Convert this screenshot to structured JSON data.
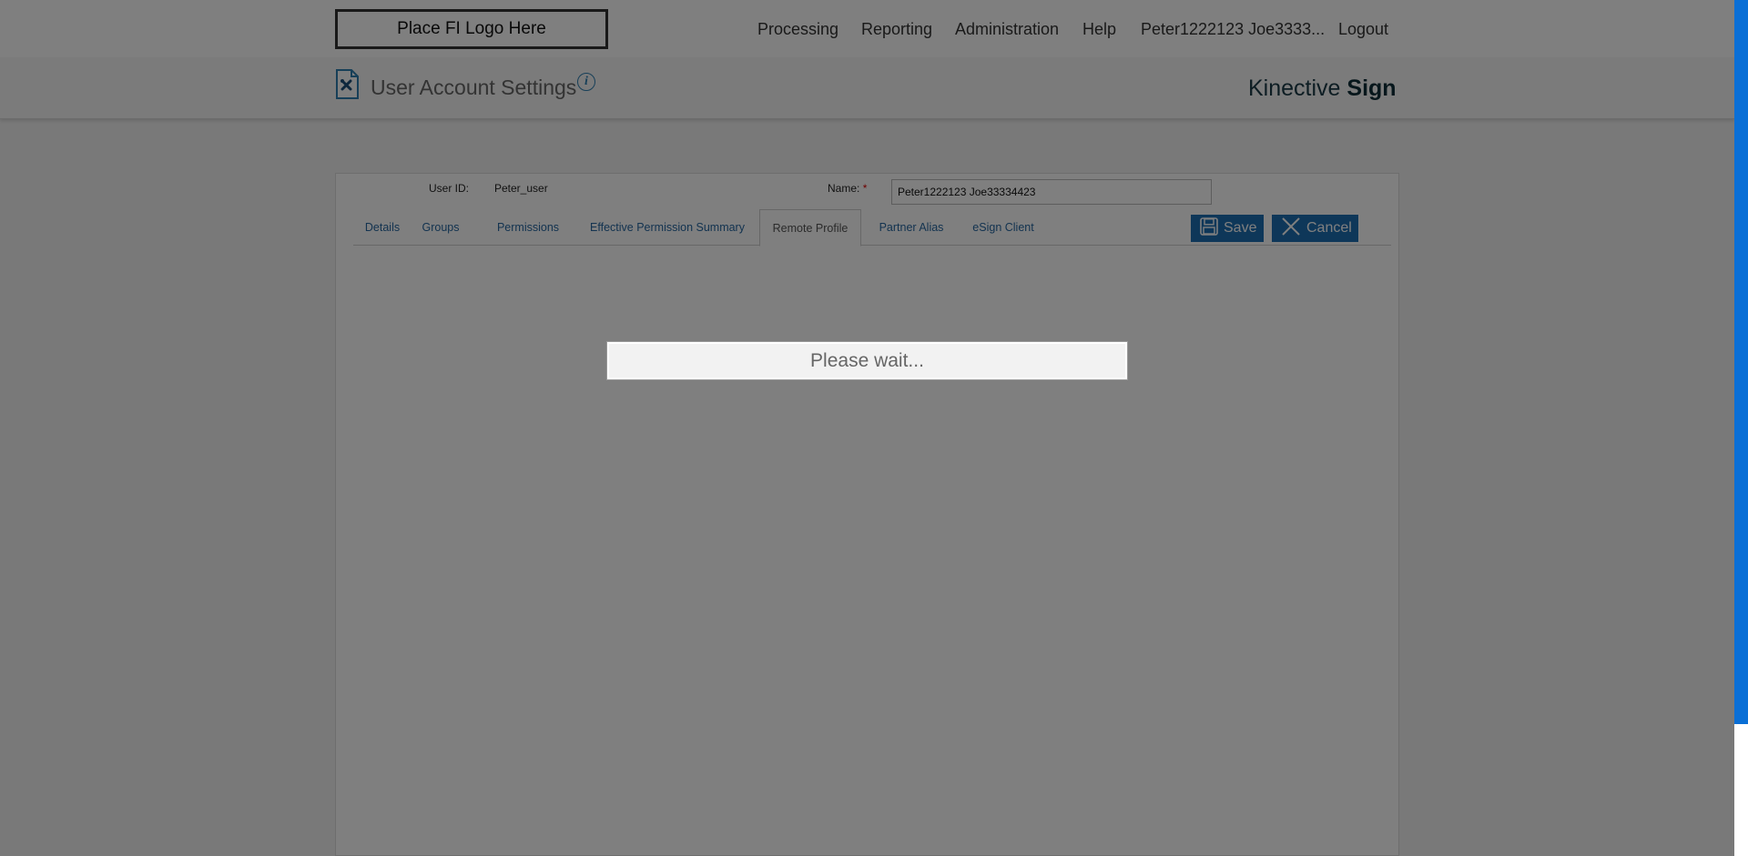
{
  "header": {
    "logo_text": "Place FI Logo Here",
    "nav": [
      "Processing",
      "Reporting",
      "Administration",
      "Help",
      "Peter1222123 Joe3333...",
      "Logout"
    ]
  },
  "subheader": {
    "page_title": "User Account Settings",
    "info_icon": "info-icon",
    "brand_light": "Kinective",
    "brand_bold": "Sign"
  },
  "form": {
    "user_id_label": "User ID:",
    "user_id_value": "Peter_user",
    "name_label": "Name:",
    "required_mark": "*",
    "name_value": "Peter1222123 Joe33334423"
  },
  "tabs": [
    {
      "label": "Details"
    },
    {
      "label": "Groups"
    },
    {
      "label": "Permissions"
    },
    {
      "label": "Effective Permission Summary"
    },
    {
      "label": "Remote Profile",
      "active": true
    },
    {
      "label": "Partner Alias"
    },
    {
      "label": "eSign Client"
    }
  ],
  "actions": {
    "save_label": "Save",
    "cancel_label": "Cancel",
    "save_icon": "floppy-disk-icon",
    "cancel_icon": "close-icon"
  },
  "overlay": {
    "message": "Please wait..."
  },
  "colors": {
    "accent": "#1d6fb3",
    "link": "#2767a0",
    "scrollbar_thumb": "#0a6fd6",
    "required": "#dd0000"
  }
}
